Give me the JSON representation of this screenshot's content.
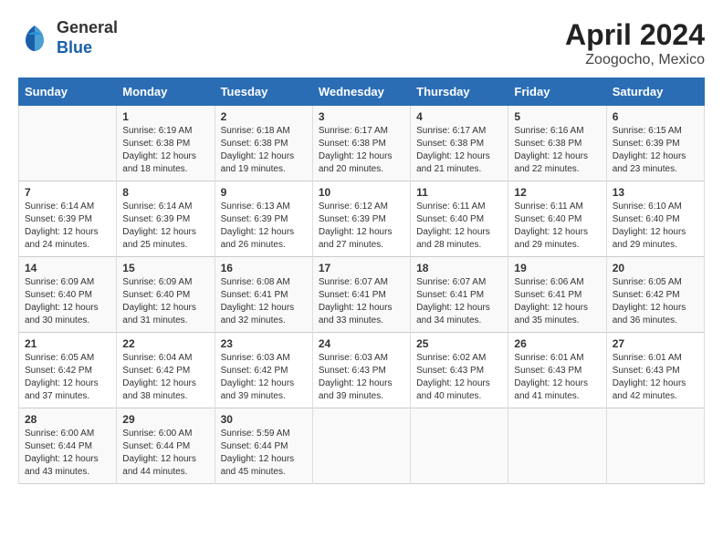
{
  "logo": {
    "general": "General",
    "blue": "Blue"
  },
  "title": {
    "month_year": "April 2024",
    "location": "Zoogocho, Mexico"
  },
  "days_header": [
    "Sunday",
    "Monday",
    "Tuesday",
    "Wednesday",
    "Thursday",
    "Friday",
    "Saturday"
  ],
  "weeks": [
    [
      {
        "num": "",
        "info": ""
      },
      {
        "num": "1",
        "info": "Sunrise: 6:19 AM\nSunset: 6:38 PM\nDaylight: 12 hours\nand 18 minutes."
      },
      {
        "num": "2",
        "info": "Sunrise: 6:18 AM\nSunset: 6:38 PM\nDaylight: 12 hours\nand 19 minutes."
      },
      {
        "num": "3",
        "info": "Sunrise: 6:17 AM\nSunset: 6:38 PM\nDaylight: 12 hours\nand 20 minutes."
      },
      {
        "num": "4",
        "info": "Sunrise: 6:17 AM\nSunset: 6:38 PM\nDaylight: 12 hours\nand 21 minutes."
      },
      {
        "num": "5",
        "info": "Sunrise: 6:16 AM\nSunset: 6:38 PM\nDaylight: 12 hours\nand 22 minutes."
      },
      {
        "num": "6",
        "info": "Sunrise: 6:15 AM\nSunset: 6:39 PM\nDaylight: 12 hours\nand 23 minutes."
      }
    ],
    [
      {
        "num": "7",
        "info": "Sunrise: 6:14 AM\nSunset: 6:39 PM\nDaylight: 12 hours\nand 24 minutes."
      },
      {
        "num": "8",
        "info": "Sunrise: 6:14 AM\nSunset: 6:39 PM\nDaylight: 12 hours\nand 25 minutes."
      },
      {
        "num": "9",
        "info": "Sunrise: 6:13 AM\nSunset: 6:39 PM\nDaylight: 12 hours\nand 26 minutes."
      },
      {
        "num": "10",
        "info": "Sunrise: 6:12 AM\nSunset: 6:39 PM\nDaylight: 12 hours\nand 27 minutes."
      },
      {
        "num": "11",
        "info": "Sunrise: 6:11 AM\nSunset: 6:40 PM\nDaylight: 12 hours\nand 28 minutes."
      },
      {
        "num": "12",
        "info": "Sunrise: 6:11 AM\nSunset: 6:40 PM\nDaylight: 12 hours\nand 29 minutes."
      },
      {
        "num": "13",
        "info": "Sunrise: 6:10 AM\nSunset: 6:40 PM\nDaylight: 12 hours\nand 29 minutes."
      }
    ],
    [
      {
        "num": "14",
        "info": "Sunrise: 6:09 AM\nSunset: 6:40 PM\nDaylight: 12 hours\nand 30 minutes."
      },
      {
        "num": "15",
        "info": "Sunrise: 6:09 AM\nSunset: 6:40 PM\nDaylight: 12 hours\nand 31 minutes."
      },
      {
        "num": "16",
        "info": "Sunrise: 6:08 AM\nSunset: 6:41 PM\nDaylight: 12 hours\nand 32 minutes."
      },
      {
        "num": "17",
        "info": "Sunrise: 6:07 AM\nSunset: 6:41 PM\nDaylight: 12 hours\nand 33 minutes."
      },
      {
        "num": "18",
        "info": "Sunrise: 6:07 AM\nSunset: 6:41 PM\nDaylight: 12 hours\nand 34 minutes."
      },
      {
        "num": "19",
        "info": "Sunrise: 6:06 AM\nSunset: 6:41 PM\nDaylight: 12 hours\nand 35 minutes."
      },
      {
        "num": "20",
        "info": "Sunrise: 6:05 AM\nSunset: 6:42 PM\nDaylight: 12 hours\nand 36 minutes."
      }
    ],
    [
      {
        "num": "21",
        "info": "Sunrise: 6:05 AM\nSunset: 6:42 PM\nDaylight: 12 hours\nand 37 minutes."
      },
      {
        "num": "22",
        "info": "Sunrise: 6:04 AM\nSunset: 6:42 PM\nDaylight: 12 hours\nand 38 minutes."
      },
      {
        "num": "23",
        "info": "Sunrise: 6:03 AM\nSunset: 6:42 PM\nDaylight: 12 hours\nand 39 minutes."
      },
      {
        "num": "24",
        "info": "Sunrise: 6:03 AM\nSunset: 6:43 PM\nDaylight: 12 hours\nand 39 minutes."
      },
      {
        "num": "25",
        "info": "Sunrise: 6:02 AM\nSunset: 6:43 PM\nDaylight: 12 hours\nand 40 minutes."
      },
      {
        "num": "26",
        "info": "Sunrise: 6:01 AM\nSunset: 6:43 PM\nDaylight: 12 hours\nand 41 minutes."
      },
      {
        "num": "27",
        "info": "Sunrise: 6:01 AM\nSunset: 6:43 PM\nDaylight: 12 hours\nand 42 minutes."
      }
    ],
    [
      {
        "num": "28",
        "info": "Sunrise: 6:00 AM\nSunset: 6:44 PM\nDaylight: 12 hours\nand 43 minutes."
      },
      {
        "num": "29",
        "info": "Sunrise: 6:00 AM\nSunset: 6:44 PM\nDaylight: 12 hours\nand 44 minutes."
      },
      {
        "num": "30",
        "info": "Sunrise: 5:59 AM\nSunset: 6:44 PM\nDaylight: 12 hours\nand 45 minutes."
      },
      {
        "num": "",
        "info": ""
      },
      {
        "num": "",
        "info": ""
      },
      {
        "num": "",
        "info": ""
      },
      {
        "num": "",
        "info": ""
      }
    ]
  ]
}
